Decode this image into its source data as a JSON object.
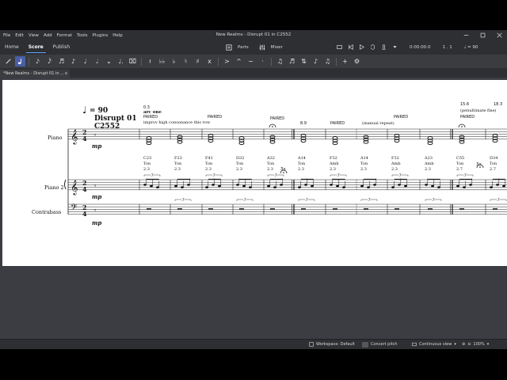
{
  "app": {
    "title": "New Realms - Disrupt 01 in C2552",
    "menu": [
      "File",
      "Edit",
      "View",
      "Add",
      "Format",
      "Tools",
      "Plugins",
      "Help"
    ]
  },
  "toolbar": {
    "tabs": [
      "Home",
      "Score",
      "Publish"
    ],
    "active_tab": "Score",
    "parts_label": "Parts",
    "mixer_label": "Mixer",
    "time": "0:00:00.0",
    "position": "1 . 1",
    "tempo_readout": "= 90"
  },
  "document_tab": {
    "label": "*New Realms - Disrupt 01 in ...",
    "close": "x"
  },
  "status": {
    "workspace": "Workspace: Default",
    "concert_pitch": "Concert pitch",
    "view_mode": "Continuous view",
    "zoom": "100%"
  },
  "score": {
    "tempo": "= 90",
    "title_line1": "Disrupt 01",
    "title_line2": "C2552",
    "instruments": [
      "Piano",
      "Piano 2",
      "Contrabass"
    ],
    "dynamic": "mp",
    "time_sig_top": "2",
    "time_sig_bottom": "4",
    "header_annotations": {
      "m1_num": "0.3",
      "m1_bold": "arc one",
      "m1_paired": "PAIRED",
      "m1_note": "improv high consonance this row",
      "m3_paired": "PAIRED",
      "m5_paired": "PAIRED",
      "m6_num": "8.9",
      "m7_paired": "PAIRED",
      "m8_repeat": "(manual repeat)",
      "m9_paired": "PAIRED",
      "m11_num": "15.6",
      "m11_pen": "(penultimate fine)",
      "m11_paired": "PAIRED",
      "m12_num": "18.3"
    },
    "measures": [
      {
        "chord": "C23",
        "kind": "Ton",
        "val": "2.3"
      },
      {
        "chord": "F23",
        "kind": "Ton",
        "val": "2.3"
      },
      {
        "chord": "F41",
        "kind": "Ton",
        "val": "2.3"
      },
      {
        "chord": "D32",
        "kind": "Ton",
        "val": "2.3"
      },
      {
        "chord": "A32",
        "kind": "Ton",
        "val": "2.3"
      },
      {
        "chord": "A14",
        "kind": "Ton",
        "val": "2.3"
      },
      {
        "chord": "F32",
        "kind": "Amb",
        "val": "2.3"
      },
      {
        "chord": "A14",
        "kind": "Ton",
        "val": "2.3"
      },
      {
        "chord": "F32",
        "kind": "Amb",
        "val": "2.3"
      },
      {
        "chord": "A23",
        "kind": "Amb",
        "val": "2.3"
      },
      {
        "chord": "C55",
        "kind": "Ton",
        "val": "2.7"
      },
      {
        "chord": "D34",
        "kind": "Ton",
        "val": "2.7"
      }
    ],
    "repeat_marks": [
      "3x",
      "3x"
    ],
    "tuplet": "3"
  }
}
